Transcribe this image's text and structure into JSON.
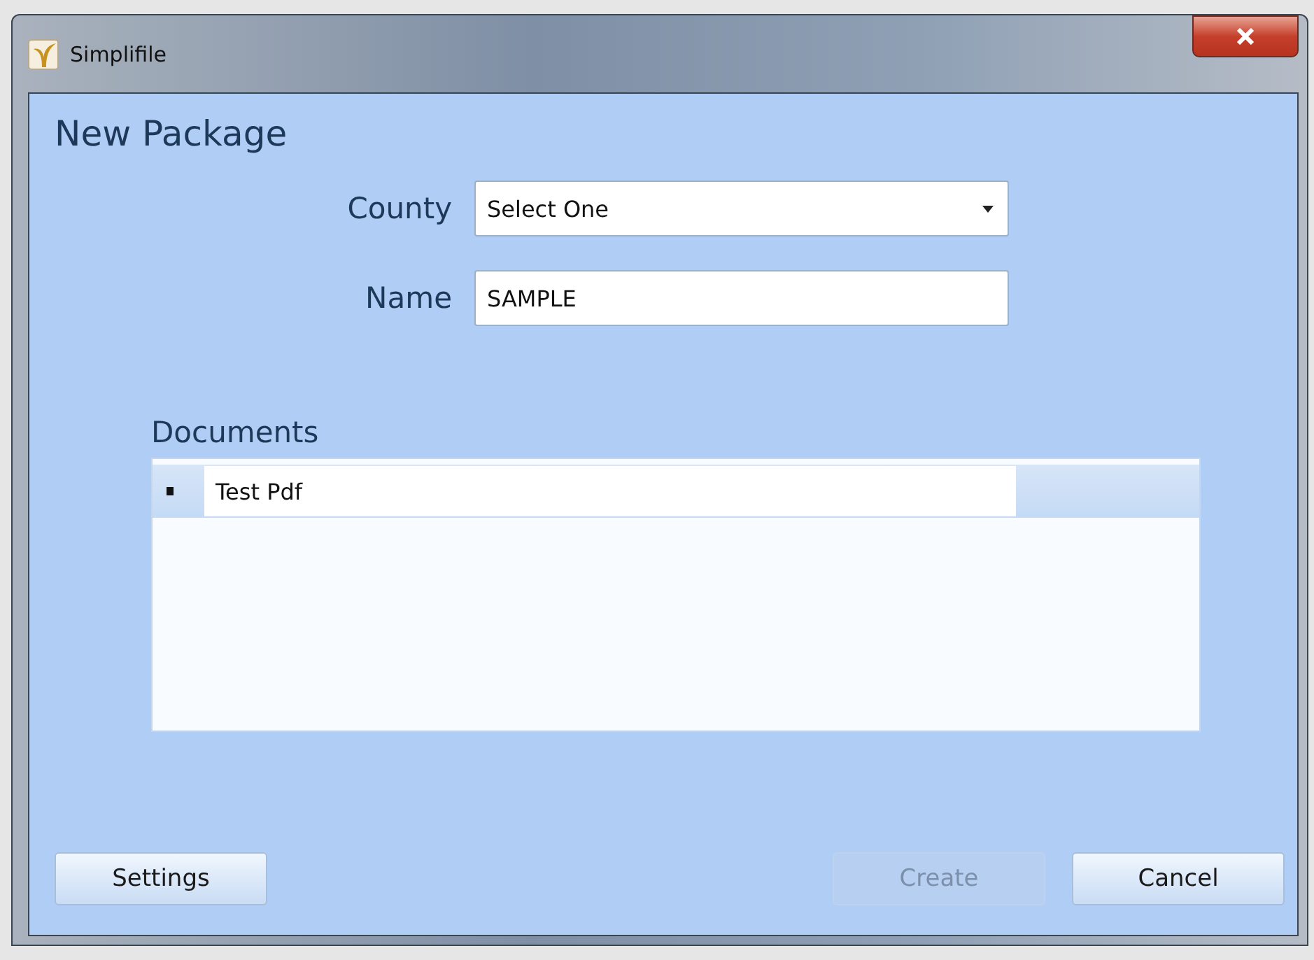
{
  "window": {
    "title": "Simplifile"
  },
  "heading": "New Package",
  "fields": [
    {
      "kind": "dropdown",
      "label": "County",
      "value": "Select One"
    },
    {
      "kind": "text",
      "label": "Name",
      "value": "SAMPLE"
    }
  ],
  "documents": {
    "label": "Documents",
    "items": [
      {
        "name": "Test Pdf",
        "selected": true
      }
    ]
  },
  "buttons": [
    {
      "label": "Settings",
      "disabled": false
    },
    {
      "label": "Create",
      "disabled": true
    },
    {
      "label": "Cancel",
      "disabled": false
    }
  ]
}
